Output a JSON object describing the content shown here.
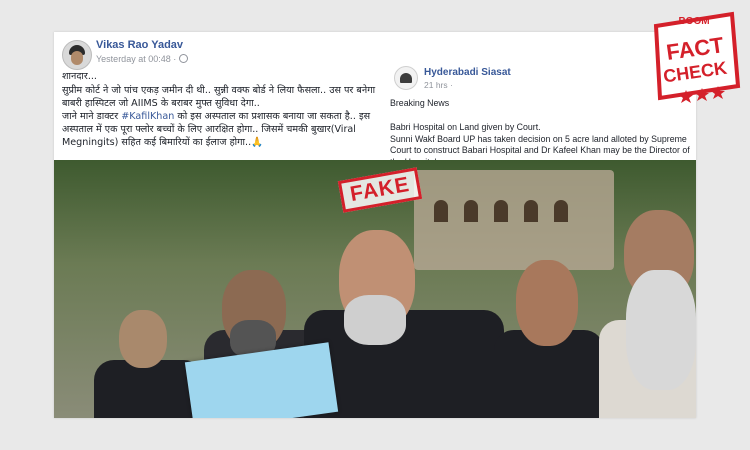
{
  "left_post": {
    "author": "Vikas Rao Yadav",
    "timestamp": "Yesterday at 00:48 ·",
    "line1": "शानदार...",
    "line2": "सुप्रीम कोर्ट ने जो पांच एकड़ जमीन दी थी.. सुन्नी वक्फ बोर्ड ने लिया फैसला.. उस पर बनेगा बाबरी हास्पिटल जो AIIMS के बराबर मुफ्त सुविधा देगा..",
    "line3a": "जाने माने डाक्टर ",
    "hashtag": "#KafilKhan",
    "line3b": " को इस अस्पताल का प्रशासक बनाया जा सकता है.. इस अस्पताल में एक पूरा फ्लोर बच्चों के लिए आरक्षित होगा.. जिसमें चमकी बुखार(Viral Megningits) सहित कई बिमारियों का ईलाज होगा..🙏"
  },
  "right_post": {
    "page_name": "Hyderabadi Siasat",
    "timestamp": "21 hrs ·",
    "label": "Breaking News",
    "headline": "Babri Hospital on Land given by Court.",
    "body": "Sunni Wakf Board UP has taken decision on 5 acre land alloted by Supreme Court to construct Babari Hospital and Dr Kafeel Khan may be the Director of the Hospital."
  },
  "fake_stamp": "FAKE",
  "factcheck": {
    "brand": "BOOM",
    "word1": "FACT",
    "word2": "CHECK"
  },
  "colors": {
    "link_blue": "#385898",
    "stamp_red": "#d4202a",
    "paper_blue": "#9ed6ee"
  },
  "icons": [
    "globe-icon",
    "avatar",
    "page-logo"
  ]
}
